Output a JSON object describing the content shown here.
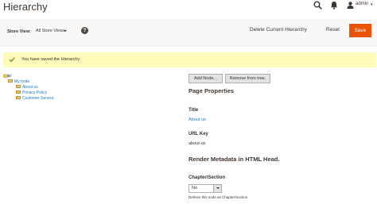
{
  "header": {
    "title": "Hierarchy",
    "user_name": "admin",
    "user_caret": "▾"
  },
  "toolbar": {
    "store_view_label": "Store View:",
    "store_view_value": "All Store Views",
    "help_symbol": "?",
    "delete_label": "Delete Current Hierarchy",
    "reset_label": "Reset",
    "save_label": "Save"
  },
  "message": {
    "text": "You have saved the Hierarchy."
  },
  "tree": {
    "root_label": "/",
    "nodes": [
      {
        "label": "My node"
      },
      {
        "label": "About us"
      },
      {
        "label": "Privacy Policy"
      },
      {
        "label": "Customer Service"
      }
    ]
  },
  "form": {
    "add_node_label": "Add Node...",
    "remove_label": "Remove from tree.",
    "page_properties_title": "Page Properties",
    "title_label": "Title",
    "title_value": "About us",
    "url_key_label": "URL Key",
    "url_key_value": "about-us",
    "metadata_title": "Render Metadata in HTML Head.",
    "chapter_label": "Chapter/Section",
    "chapter_value": "No",
    "chapter_note": "Defines this node as Chapter/Section"
  },
  "colors": {
    "accent": "#eb5202",
    "link": "#1979c3",
    "message_bg": "#fffbbb",
    "success": "#79a22e"
  }
}
